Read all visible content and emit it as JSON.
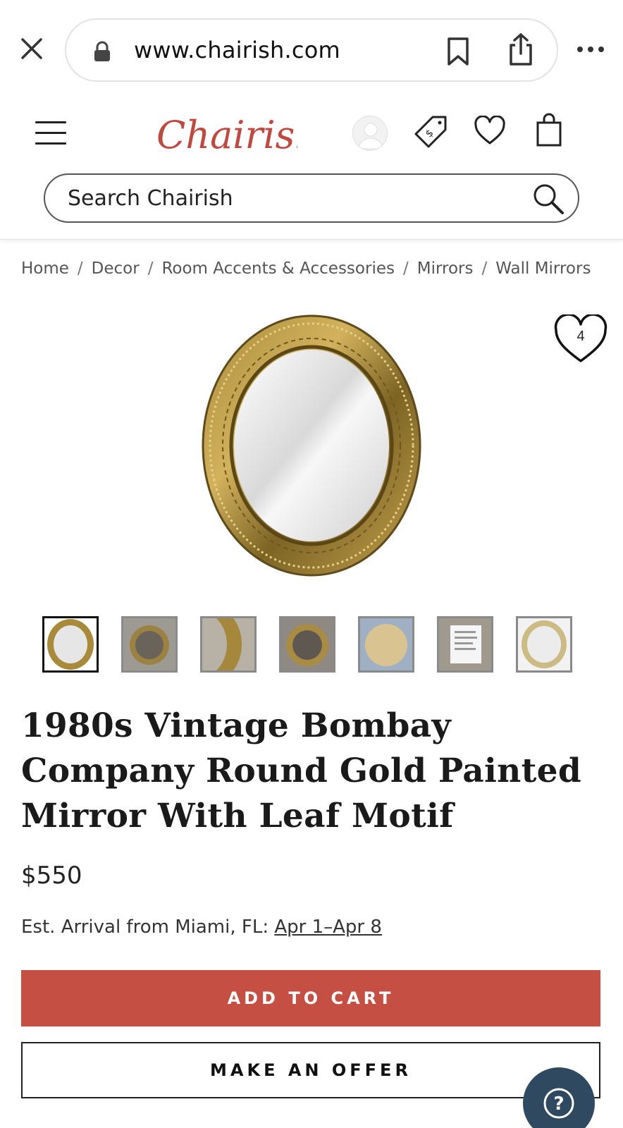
{
  "browser": {
    "url": "www.chairish.com"
  },
  "header": {
    "logo_text": "Chairish",
    "search_placeholder": "Search Chairish"
  },
  "breadcrumb": [
    "Home",
    "Decor",
    "Room Accents & Accessories",
    "Mirrors",
    "Wall Mirrors"
  ],
  "product": {
    "favorite_count": "4",
    "title": "1980s Vintage Bombay Company Round Gold Painted Mirror With Leaf Motif",
    "price": "$550",
    "arrival_label": "Est. Arrival from Miami, FL:",
    "arrival_dates": "Apr 1–Apr 8",
    "thumbnail_count": 7
  },
  "actions": {
    "add_to_cart": "ADD TO CART",
    "make_offer": "MAKE AN OFFER"
  },
  "colors": {
    "brand_red": "#c54f43",
    "help_button": "#2f4a60"
  }
}
